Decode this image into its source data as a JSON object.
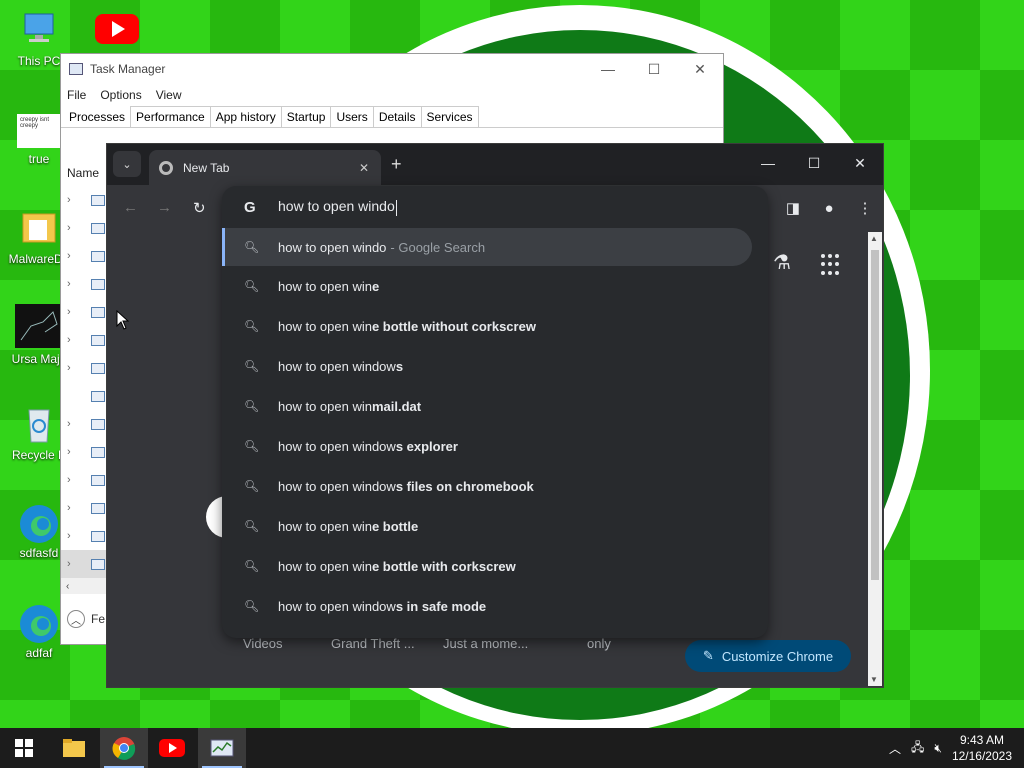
{
  "desktop": {
    "icons": [
      {
        "label": "This PC"
      },
      {
        "label": ""
      },
      {
        "label": "true",
        "thumb_text": "creepy isnt creepy"
      },
      {
        "label": "MalwareDa"
      },
      {
        "label": "Ursa Majo"
      },
      {
        "label": "Recycle B"
      },
      {
        "label": "sdfasfd"
      },
      {
        "label": "adfaf"
      }
    ]
  },
  "task_manager": {
    "title": "Task Manager",
    "menu": [
      "File",
      "Options",
      "View"
    ],
    "tabs": [
      "Processes",
      "Performance",
      "App history",
      "Startup",
      "Users",
      "Details",
      "Services"
    ],
    "active_tab": "Processes",
    "column_name": "Name",
    "footer_label": "Fe"
  },
  "chrome": {
    "tab_title": "New Tab",
    "omnibox": {
      "value": "how to open windo",
      "suggestions": [
        {
          "typed": "how to open windo",
          "rest": "",
          "suffix": "- Google Search"
        },
        {
          "typed": "how to open win",
          "rest": "e",
          "suffix": ""
        },
        {
          "typed": "how to open win",
          "rest": "e bottle without corkscrew",
          "suffix": ""
        },
        {
          "typed": "how to open window",
          "rest": "s",
          "suffix": ""
        },
        {
          "typed": "how to open win",
          "rest": "mail.dat",
          "suffix": ""
        },
        {
          "typed": "how to open window",
          "rest": "s explorer",
          "suffix": ""
        },
        {
          "typed": "how to open window",
          "rest": "s files on chromebook",
          "suffix": ""
        },
        {
          "typed": "how to open win",
          "rest": "e bottle",
          "suffix": ""
        },
        {
          "typed": "how to open win",
          "rest": "e bottle with corkscrew",
          "suffix": ""
        },
        {
          "typed": "how to open window",
          "rest": "s in safe mode",
          "suffix": ""
        }
      ]
    },
    "shortcuts": [
      "Videos",
      "Grand Theft ...",
      "Just a mome...",
      "only"
    ],
    "customize_label": "Customize Chrome"
  },
  "taskbar": {
    "clock_time": "9:43 AM",
    "clock_date": "12/16/2023"
  },
  "colors": {
    "desktop_green": "#32d419",
    "chrome_bg": "#202124",
    "chrome_toolbar": "#35363a",
    "omnibox_bg": "#282a2d",
    "accent_blue": "#8ab4f8",
    "customize_bg": "#004a77"
  }
}
